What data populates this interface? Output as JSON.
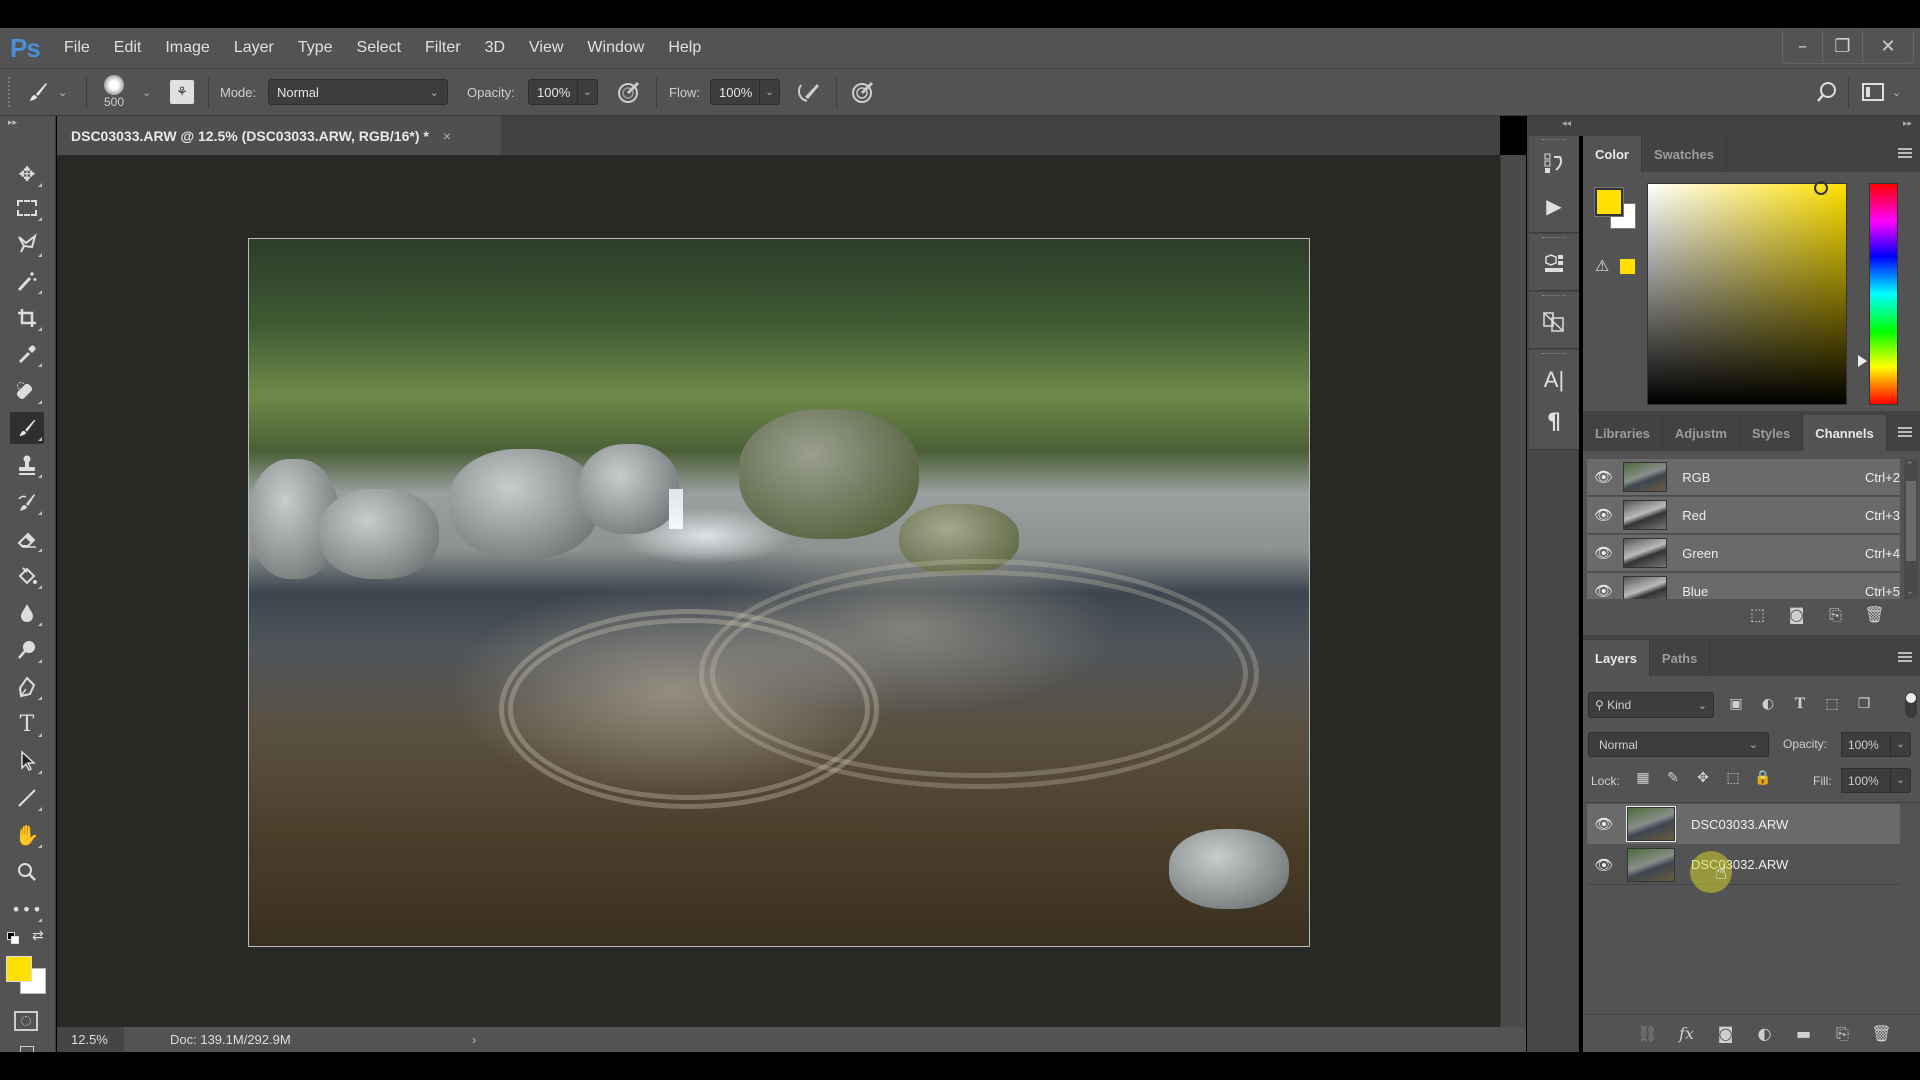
{
  "app": {
    "logo": "Ps",
    "window_controls": {
      "minimize": "–",
      "restore": "❐",
      "close": "✕"
    }
  },
  "menu": [
    "File",
    "Edit",
    "Image",
    "Layer",
    "Type",
    "Select",
    "Filter",
    "3D",
    "View",
    "Window",
    "Help"
  ],
  "options_bar": {
    "tool_icon": "brush-icon",
    "brush_size": "500",
    "mode_label": "Mode:",
    "mode_value": "Normal",
    "opacity_label": "Opacity:",
    "opacity_value": "100%",
    "flow_label": "Flow:",
    "flow_value": "100%"
  },
  "document": {
    "tab_title": "DSC03033.ARW @ 12.5% (DSC03033.ARW, RGB/16*) *",
    "close": "×"
  },
  "status_bar": {
    "zoom": "12.5%",
    "doc_info": "Doc: 139.1M/292.9M",
    "arrow": "›"
  },
  "colors": {
    "foreground": "#ffe000",
    "background": "#ffffff"
  },
  "color_panel": {
    "tabs": [
      "Color",
      "Swatches"
    ],
    "active_tab": "Color"
  },
  "channels_panel": {
    "tabs": [
      "Libraries",
      "Adjustm",
      "Styles",
      "Channels"
    ],
    "active_tab": "Channels",
    "channels": [
      {
        "name": "RGB",
        "shortcut": "Ctrl+2"
      },
      {
        "name": "Red",
        "shortcut": "Ctrl+3"
      },
      {
        "name": "Green",
        "shortcut": "Ctrl+4"
      },
      {
        "name": "Blue",
        "shortcut": "Ctrl+5"
      }
    ]
  },
  "layers_panel": {
    "tabs": [
      "Layers",
      "Paths"
    ],
    "active_tab": "Layers",
    "filter_label": "Kind",
    "blend_mode": "Normal",
    "opacity_label": "Opacity:",
    "opacity_value": "100%",
    "lock_label": "Lock:",
    "fill_label": "Fill:",
    "fill_value": "100%",
    "layers": [
      {
        "name": "DSC03033.ARW",
        "selected": true
      },
      {
        "name": "DSC03032.ARW",
        "selected": false
      }
    ]
  }
}
